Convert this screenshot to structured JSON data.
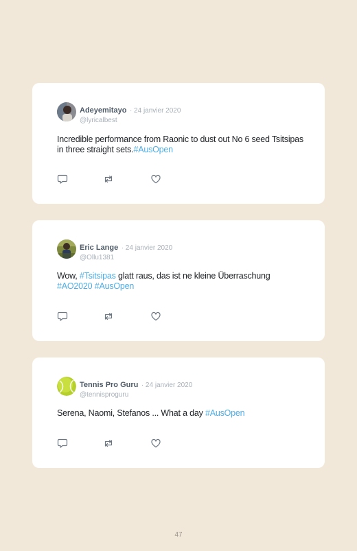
{
  "tweets": [
    {
      "name": "Adeyemitayo",
      "date": "· 24 janvier 2020",
      "handle": "@lyricalbest",
      "text_segments": [
        {
          "text": "Incredible performance from Raonic to dust out No 6 seed Tsitsipas in three straight sets.",
          "tag": false
        },
        {
          "text": "#AusOpen",
          "tag": true
        }
      ],
      "avatar_icon": "person-photo-icon"
    },
    {
      "name": "Eric Lange",
      "date": "· 24 janvier 2020",
      "handle": "@Ollu1381",
      "text_segments": [
        {
          "text": "Wow, ",
          "tag": false
        },
        {
          "text": "#Tsitsipas",
          "tag": true
        },
        {
          "text": " glatt raus, das ist ne kleine Überraschung ",
          "tag": false
        },
        {
          "text": "#AO2020",
          "tag": true
        },
        {
          "text": " ",
          "tag": false
        },
        {
          "text": "#AusOpen",
          "tag": true
        }
      ],
      "avatar_icon": "person-photo-icon"
    },
    {
      "name": "Tennis Pro Guru",
      "date": "· 24 janvier 2020",
      "handle": "@tennisproguru",
      "text_segments": [
        {
          "text": "Serena, Naomi, Stefanos ... What a day ",
          "tag": false
        },
        {
          "text": "#AusOpen",
          "tag": true
        }
      ],
      "avatar_icon": "tennis-ball-icon"
    }
  ],
  "page_number": "47",
  "colors": {
    "background": "#f2e8da",
    "card": "#ffffff",
    "hashtag": "#4faee6",
    "name": "#4e5a66",
    "muted": "#a8b0b8"
  }
}
